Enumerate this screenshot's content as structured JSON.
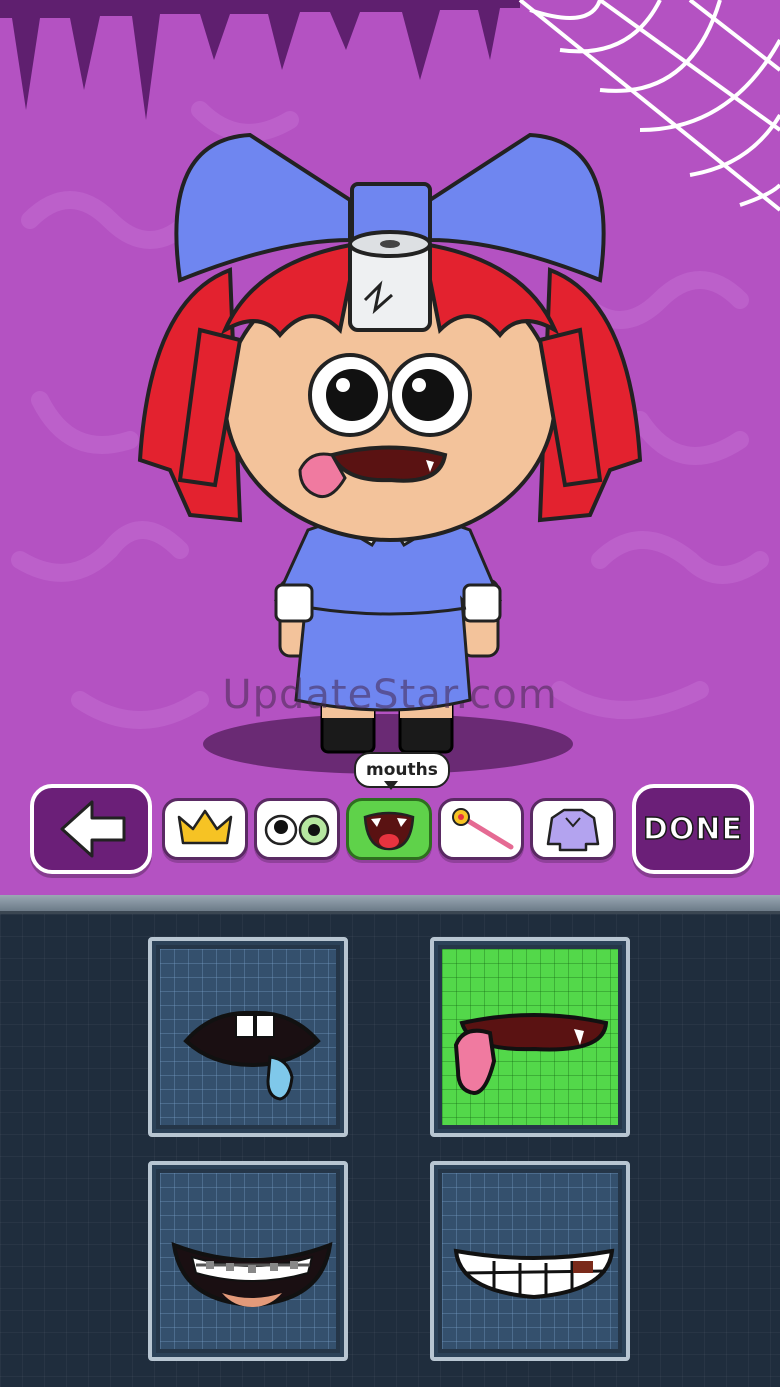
{
  "watermark": "UpdateStar.com",
  "toolbar": {
    "back_icon": "left-arrow-icon",
    "done_label": "DONE",
    "active_category_tooltip": "mouths",
    "categories": [
      {
        "name": "hats",
        "icon": "crown-icon"
      },
      {
        "name": "eyes",
        "icon": "eyes-icon"
      },
      {
        "name": "mouths",
        "icon": "mouth-icon",
        "active": true
      },
      {
        "name": "accessories",
        "icon": "wand-icon"
      },
      {
        "name": "outfits",
        "icon": "shirt-icon"
      }
    ]
  },
  "mouth_options": [
    {
      "icon": "mouth-drool-icon",
      "selected": false
    },
    {
      "icon": "mouth-tongue-icon",
      "selected": true
    },
    {
      "icon": "mouth-braces-icon",
      "selected": false
    },
    {
      "icon": "mouth-grin-icon",
      "selected": false
    }
  ],
  "colors": {
    "background": "#b452c2",
    "button_purple": "#6b1f78",
    "active_green": "#5fd24a",
    "panel_dark": "#1f2d3d"
  }
}
